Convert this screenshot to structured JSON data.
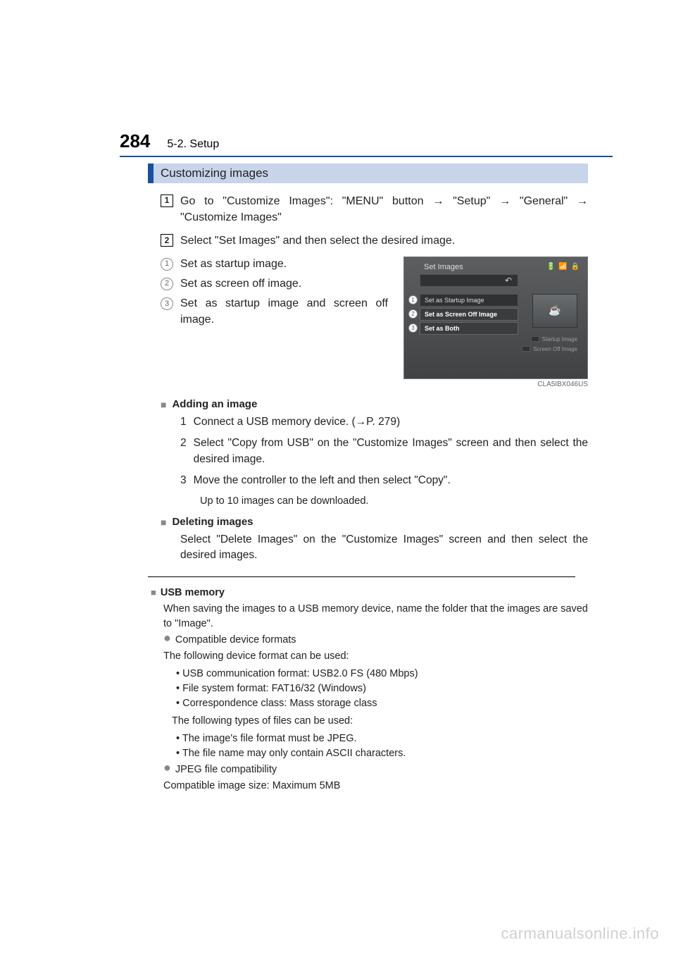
{
  "header": {
    "page_number": "284",
    "chapter": "5-2. Setup"
  },
  "section_title": "Customizing images",
  "steps": {
    "s1_pre": "Go to \"Customize Images\": \"MENU\" button ",
    "s1_a": "\"Setup\" ",
    "s1_b": "\"General\" ",
    "s1_c": "\"Customize Images\"",
    "s2": "Select \"Set Images\" and then select the desired image."
  },
  "options": {
    "o1": "Set as startup image.",
    "o2": "Set as screen off image.",
    "o3": "Set as startup image and screen off image."
  },
  "screen": {
    "title": "Set Images",
    "row1": "Set as Startup Image",
    "row2": "Set as Screen Off Image",
    "row3": "Set as Both",
    "legend1": "Startup Image",
    "legend2": "Screen Off Image",
    "code": "CLA5IBX046US"
  },
  "adding": {
    "heading": "Adding an image",
    "s1_a": "Connect a USB memory device. (",
    "s1_b": "P. 279)",
    "s2": "Select \"Copy from USB\" on the \"Customize Images\" screen and then select the desired image.",
    "s3": "Move the controller to the left and then select \"Copy\".",
    "note": "Up to 10 images can be downloaded."
  },
  "deleting": {
    "heading": "Deleting images",
    "body": "Select \"Delete Images\" on the \"Customize Images\" screen and then select the desired images."
  },
  "usb": {
    "heading": "USB memory",
    "intro": "When saving the images to a USB memory device, name the folder that the images are saved to \"Image\".",
    "compat_h": "Compatible device formats",
    "compat_intro": "The following device format can be used:",
    "d1": "USB communication format: USB2.0 FS (480 Mbps)",
    "d2": "File system format: FAT16/32 (Windows)",
    "d3": "Correspondence class: Mass storage class",
    "file_intro": "The following types of files can be used:",
    "f1": "The image's file format must be JPEG.",
    "f2": "The file name may only contain ASCII characters.",
    "jpeg_h": "JPEG file compatibility",
    "jpeg_body": "Compatible image size: Maximum 5MB"
  },
  "watermark": "carmanualsonline.info"
}
